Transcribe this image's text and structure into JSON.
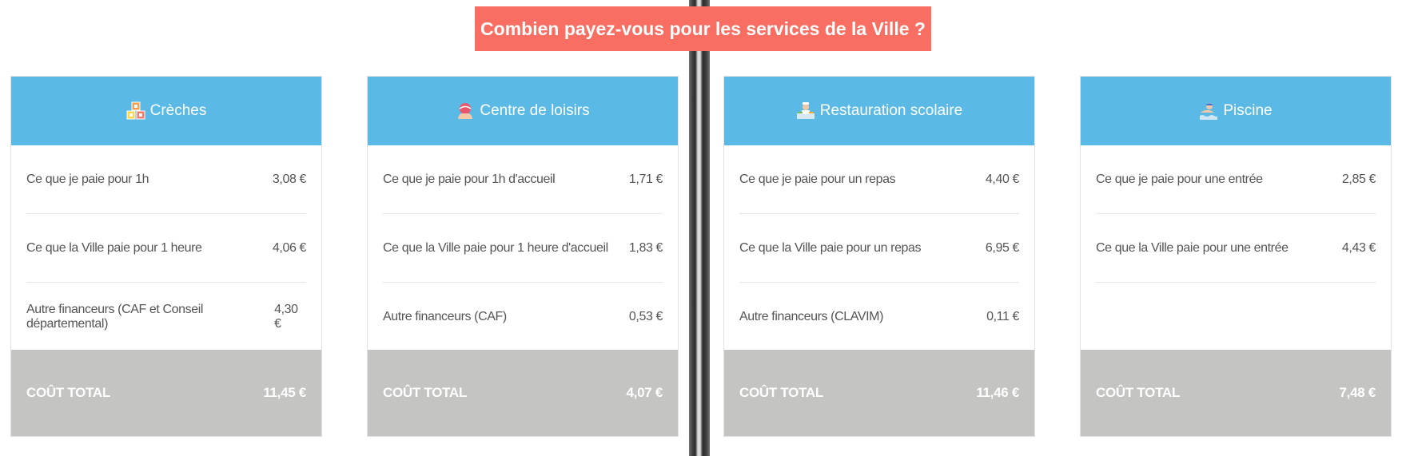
{
  "title": "Combien payez-vous pour les services de la Ville ?",
  "colors": {
    "title_bg": "#f86e62",
    "header_bg": "#5bbae5",
    "total_bg": "#c4c5c3"
  },
  "cards": [
    {
      "name": "Crèches",
      "icon": "blocks-icon",
      "rows": [
        {
          "label": "Ce que je paie pour 1h",
          "value": "3,08 €"
        },
        {
          "label": "Ce que la Ville paie pour 1 heure",
          "value": "4,06 €"
        },
        {
          "label": "Autre financeurs (CAF et Conseil départemental)",
          "value": "4,30 €"
        }
      ],
      "total_label": "COÛT TOTAL",
      "total_value": "11,45 €"
    },
    {
      "name": "Centre de loisirs",
      "icon": "ball-icon",
      "rows": [
        {
          "label": "Ce que je paie pour 1h d'accueil",
          "value": "1,71 €"
        },
        {
          "label": "Ce que la Ville paie pour 1 heure d'accueil",
          "value": "1,83 €"
        },
        {
          "label": "Autre financeurs (CAF)",
          "value": "0,53 €"
        }
      ],
      "total_label": "COÛT TOTAL",
      "total_value": "4,07 €"
    },
    {
      "name": "Restauration scolaire",
      "icon": "canteen-icon",
      "rows": [
        {
          "label": "Ce que je paie pour un repas",
          "value": "4,40 €"
        },
        {
          "label": "Ce que la Ville paie pour un repas",
          "value": "6,95 €"
        },
        {
          "label": "Autre financeurs (CLAVIM)",
          "value": "0,11 €"
        }
      ],
      "total_label": "COÛT TOTAL",
      "total_value": "11,46 €"
    },
    {
      "name": "Piscine",
      "icon": "swimmer-icon",
      "rows": [
        {
          "label": "Ce que je paie pour une entrée",
          "value": "2,85 €"
        },
        {
          "label": "Ce que la Ville paie pour une entrée",
          "value": "4,43 €"
        }
      ],
      "total_label": "COÛT TOTAL",
      "total_value": "7,48 €"
    }
  ]
}
